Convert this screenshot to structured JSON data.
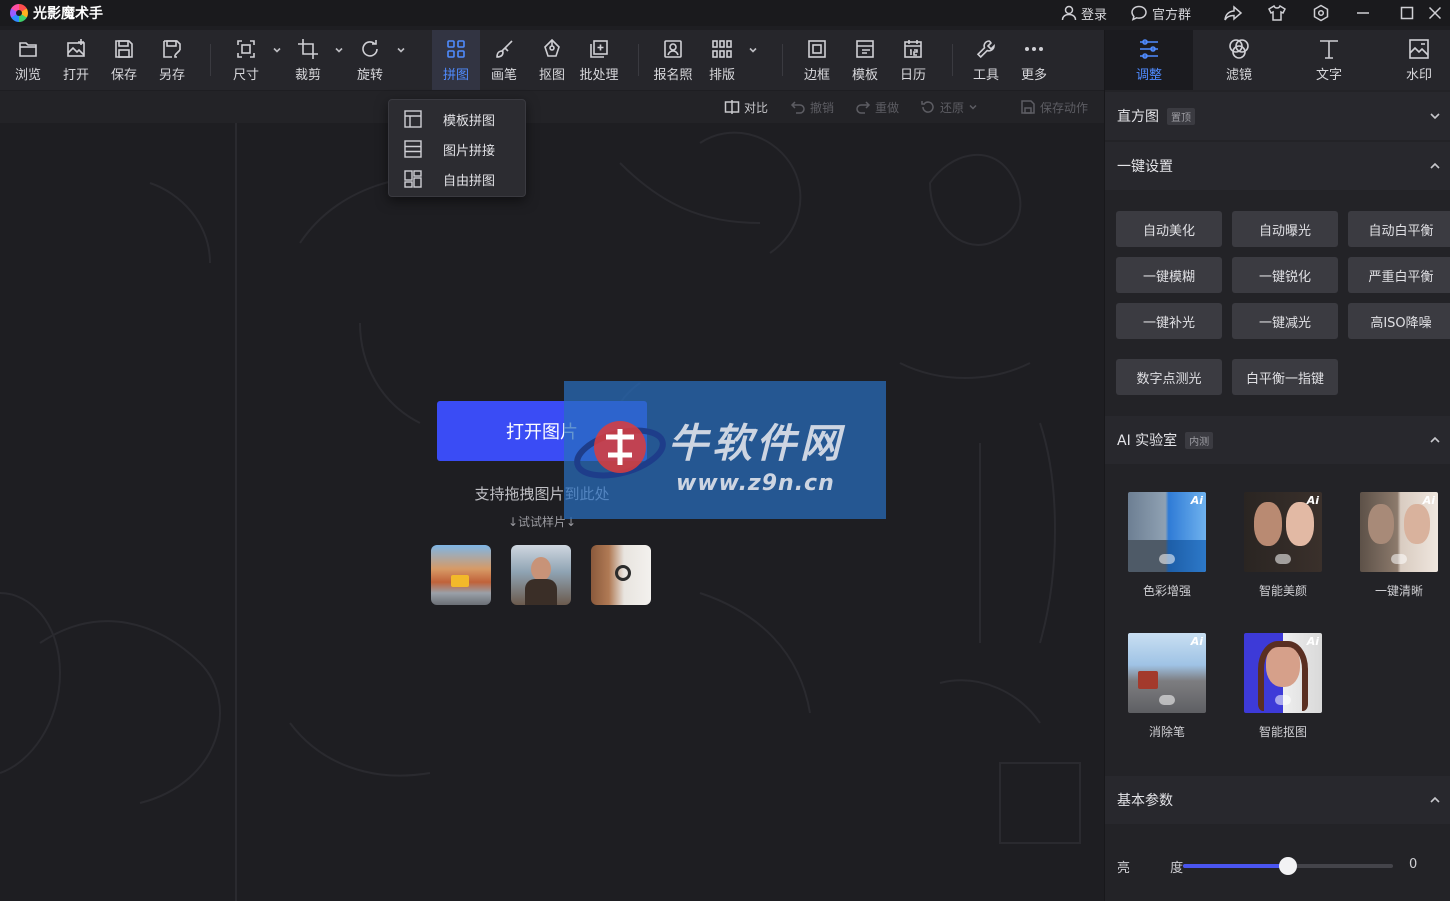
{
  "app": {
    "title": "光影魔术手"
  },
  "titlebar": {
    "login": "登录",
    "group": "官方群"
  },
  "toolbar": {
    "items": [
      {
        "label": "浏览",
        "icon": "folder-icon"
      },
      {
        "label": "打开",
        "icon": "open-image-icon"
      },
      {
        "label": "保存",
        "icon": "save-icon"
      },
      {
        "label": "另存",
        "icon": "save-as-icon"
      },
      {
        "label": "尺寸",
        "icon": "resize-icon"
      },
      {
        "label": "裁剪",
        "icon": "crop-icon"
      },
      {
        "label": "旋转",
        "icon": "rotate-icon"
      },
      {
        "label": "拼图",
        "icon": "collage-icon"
      },
      {
        "label": "画笔",
        "icon": "brush-icon"
      },
      {
        "label": "抠图",
        "icon": "cutout-icon"
      },
      {
        "label": "批处理",
        "icon": "batch-icon"
      },
      {
        "label": "报名照",
        "icon": "id-photo-icon"
      },
      {
        "label": "排版",
        "icon": "layout-icon"
      },
      {
        "label": "边框",
        "icon": "border-icon"
      },
      {
        "label": "模板",
        "icon": "template-icon"
      },
      {
        "label": "日历",
        "icon": "calendar-icon"
      },
      {
        "label": "工具",
        "icon": "wrench-icon"
      },
      {
        "label": "更多",
        "icon": "more-icon"
      }
    ],
    "active": "拼图"
  },
  "subbar": {
    "compare": "对比",
    "undo": "撤销",
    "redo": "重做",
    "restore": "还原",
    "save_action": "保存动作"
  },
  "dropdown": {
    "items": [
      "模板拼图",
      "图片拼接",
      "自由拼图"
    ]
  },
  "canvas": {
    "open_button": "打开图片",
    "drag_hint": "支持拖拽图片到此处",
    "try_sample": "↓试试样片↓"
  },
  "watermark": {
    "name": "牛软件网",
    "url": "www.z9n.cn"
  },
  "right_panel": {
    "tabs": [
      {
        "label": "调整",
        "icon": "sliders-icon"
      },
      {
        "label": "滤镜",
        "icon": "filter-icon"
      },
      {
        "label": "文字",
        "icon": "text-icon"
      },
      {
        "label": "水印",
        "icon": "watermark-icon"
      }
    ],
    "active_tab": "调整",
    "histogram": {
      "title": "直方图",
      "tag": "置顶"
    },
    "one_click": {
      "title": "一键设置",
      "buttons": [
        "自动美化",
        "自动曝光",
        "自动白平衡",
        "一键模糊",
        "一键锐化",
        "严重白平衡",
        "一键补光",
        "一键减光",
        "高ISO降噪",
        "数字点测光",
        "白平衡一指键"
      ]
    },
    "ai_lab": {
      "title": "AI 实验室",
      "tag": "内测",
      "items": [
        "色彩增强",
        "智能美颜",
        "一键清晰",
        "消除笔",
        "智能抠图"
      ],
      "badge": "Ai"
    },
    "basic": {
      "title": "基本参数",
      "brightness_label": "亮 度",
      "brightness_value": "0",
      "brightness_fraction": 0.5
    }
  },
  "colors": {
    "accent": "#3a4cf5",
    "active_blue": "#4f8bff",
    "panel": "#232327",
    "canvas": "#1e1e22"
  }
}
